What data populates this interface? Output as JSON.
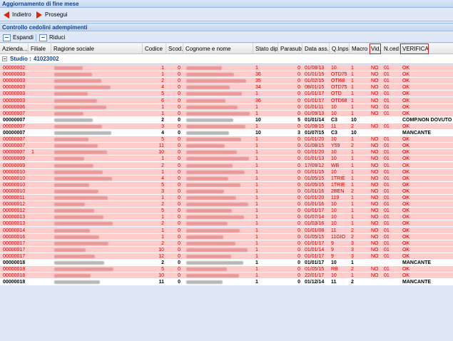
{
  "window": {
    "title": "Aggiornamento di fine mese"
  },
  "nav": {
    "back_label": "Indietro",
    "next_label": "Prosegui"
  },
  "section": {
    "title": "Controllo cedolini adempimenti"
  },
  "toolbar": {
    "expand_label": "Espandi",
    "collapse_label": "Riduci"
  },
  "columns": [
    "Azienda...",
    "Filiale",
    "Ragione sociale",
    "Codice",
    "Scod.",
    "Cognome e nome",
    "Stato dip.",
    "Parasub.",
    "Data ass.",
    "Q.Inps",
    "Macro",
    "Vid.",
    "N.ced",
    "VERIFICA"
  ],
  "group": {
    "label": "Studio :",
    "value": "41023002"
  },
  "rows": [
    {
      "azienda": "00000002",
      "filiale": "",
      "codice": "1",
      "scod": "0",
      "stato": "1",
      "parasub": "0",
      "data": "01/08/13",
      "qinps": "10",
      "macro": "1",
      "vid": "NO",
      "nced": "01",
      "verifica": "OK",
      "red": true
    },
    {
      "azienda": "00000003",
      "filiale": "",
      "codice": "1",
      "scod": "0",
      "stato": "36",
      "parasub": "0",
      "data": "01/01/15",
      "qinps": "OTD75",
      "macro": "1",
      "vid": "NO",
      "nced": "01",
      "verifica": "OK",
      "red": true
    },
    {
      "azienda": "00000003",
      "filiale": "",
      "codice": "2",
      "scod": "0",
      "stato": "35",
      "parasub": "0",
      "data": "01/02/15",
      "qinps": "OTI68",
      "macro": "1",
      "vid": "NO",
      "nced": "01",
      "verifica": "OK",
      "red": true
    },
    {
      "azienda": "00000003",
      "filiale": "",
      "codice": "4",
      "scod": "0",
      "stato": "34",
      "parasub": "0",
      "data": "08/01/15",
      "qinps": "OTD75",
      "macro": "1",
      "vid": "NO",
      "nced": "01",
      "verifica": "OK",
      "red": true
    },
    {
      "azienda": "00000003",
      "filiale": "",
      "codice": "5",
      "scod": "0",
      "stato": "1",
      "parasub": "0",
      "data": "01/01/17",
      "qinps": "OTD",
      "macro": "1",
      "vid": "NO",
      "nced": "01",
      "verifica": "OK",
      "red": true
    },
    {
      "azienda": "00000003",
      "filiale": "",
      "codice": "6",
      "scod": "0",
      "stato": "36",
      "parasub": "0",
      "data": "01/01/17",
      "qinps": "OTD68",
      "macro": "1",
      "vid": "NO",
      "nced": "01",
      "verifica": "OK",
      "red": true
    },
    {
      "azienda": "00000006",
      "filiale": "",
      "codice": "1",
      "scod": "0",
      "stato": "1",
      "parasub": "0",
      "data": "01/01/11",
      "qinps": "10",
      "macro": "1",
      "vid": "NO",
      "nced": "01",
      "verifica": "OK",
      "red": true
    },
    {
      "azienda": "00000007",
      "filiale": "",
      "codice": "1",
      "scod": "0",
      "stato": "1",
      "parasub": "0",
      "data": "01/09/13",
      "qinps": "10",
      "macro": "1",
      "vid": "NO",
      "nced": "01",
      "verifica": "OK",
      "red": true
    },
    {
      "azienda": "00000007",
      "filiale": "",
      "codice": "2",
      "scod": "0",
      "stato": "10",
      "parasub": "5",
      "data": "01/01/14",
      "qinps": "C3",
      "macro": "10",
      "vid": "",
      "nced": "",
      "verifica": "COMP.NON DOVUTO",
      "red": false
    },
    {
      "azienda": "00000007",
      "filiale": "",
      "codice": "3",
      "scod": "0",
      "stato": "1",
      "parasub": "0",
      "data": "01/08/15",
      "qinps": "11",
      "macro": "2",
      "vid": "NO",
      "nced": "01",
      "verifica": "OK",
      "red": true
    },
    {
      "azienda": "00000007",
      "filiale": "",
      "codice": "4",
      "scod": "0",
      "stato": "10",
      "parasub": "3",
      "data": "01/07/15",
      "qinps": "C3",
      "macro": "10",
      "vid": "",
      "nced": "",
      "verifica": "MANCANTE",
      "red": false
    },
    {
      "azienda": "00000007",
      "filiale": "",
      "codice": "5",
      "scod": "0",
      "stato": "1",
      "parasub": "0",
      "data": "01/01/20",
      "qinps": "10",
      "macro": "1",
      "vid": "NO",
      "nced": "01",
      "verifica": "OK",
      "red": true
    },
    {
      "azienda": "00000007",
      "filiale": "",
      "codice": "11",
      "scod": "0",
      "stato": "1",
      "parasub": "0",
      "data": "01/08/15",
      "qinps": "Y59",
      "macro": "2",
      "vid": "NO",
      "nced": "01",
      "verifica": "OK",
      "red": true
    },
    {
      "azienda": "00000007",
      "filiale": "1",
      "codice": "10",
      "scod": "0",
      "stato": "1",
      "parasub": "0",
      "data": "01/01/20",
      "qinps": "10",
      "macro": "1",
      "vid": "NO",
      "nced": "01",
      "verifica": "OK",
      "red": true
    },
    {
      "azienda": "00000009",
      "filiale": "",
      "codice": "1",
      "scod": "0",
      "stato": "1",
      "parasub": "0",
      "data": "01/01/13",
      "qinps": "10",
      "macro": "1",
      "vid": "NO",
      "nced": "01",
      "verifica": "OK",
      "red": true
    },
    {
      "azienda": "00000009",
      "filiale": "",
      "codice": "2",
      "scod": "0",
      "stato": "1",
      "parasub": "0",
      "data": "17/09/12",
      "qinps": "WB",
      "macro": "1",
      "vid": "NO",
      "nced": "01",
      "verifica": "OK",
      "red": true
    },
    {
      "azienda": "00000010",
      "filiale": "",
      "codice": "1",
      "scod": "0",
      "stato": "1",
      "parasub": "0",
      "data": "01/01/15",
      "qinps": "10",
      "macro": "1",
      "vid": "NO",
      "nced": "01",
      "verifica": "OK",
      "red": true
    },
    {
      "azienda": "00000010",
      "filiale": "",
      "codice": "4",
      "scod": "0",
      "stato": "1",
      "parasub": "0",
      "data": "01/05/15",
      "qinps": "1TRIE",
      "macro": "1",
      "vid": "NO",
      "nced": "01",
      "verifica": "OK",
      "red": true
    },
    {
      "azienda": "00000010",
      "filiale": "",
      "codice": "5",
      "scod": "0",
      "stato": "1",
      "parasub": "0",
      "data": "01/05/15",
      "qinps": "1TRIE",
      "macro": "1",
      "vid": "NO",
      "nced": "01",
      "verifica": "OK",
      "red": true
    },
    {
      "azienda": "00000010",
      "filiale": "",
      "codice": "3",
      "scod": "0",
      "stato": "1",
      "parasub": "0",
      "data": "01/01/16",
      "qinps": "2BEN",
      "macro": "2",
      "vid": "NO",
      "nced": "01",
      "verifica": "OK",
      "red": true
    },
    {
      "azienda": "00000011",
      "filiale": "",
      "codice": "1",
      "scod": "0",
      "stato": "1",
      "parasub": "0",
      "data": "01/01/20",
      "qinps": "119",
      "macro": "1",
      "vid": "NO",
      "nced": "01",
      "verifica": "OK",
      "red": true
    },
    {
      "azienda": "00000012",
      "filiale": "",
      "codice": "2",
      "scod": "0",
      "stato": "1",
      "parasub": "0",
      "data": "01/01/16",
      "qinps": "10",
      "macro": "1",
      "vid": "NO",
      "nced": "01",
      "verifica": "OK",
      "red": true
    },
    {
      "azienda": "00000012",
      "filiale": "",
      "codice": "5",
      "scod": "0",
      "stato": "1",
      "parasub": "0",
      "data": "01/01/17",
      "qinps": "10",
      "macro": "1",
      "vid": "NO",
      "nced": "01",
      "verifica": "OK",
      "red": true
    },
    {
      "azienda": "00000013",
      "filiale": "",
      "codice": "1",
      "scod": "0",
      "stato": "1",
      "parasub": "0",
      "data": "01/07/14",
      "qinps": "10",
      "macro": "1",
      "vid": "NO",
      "nced": "01",
      "verifica": "OK",
      "red": true
    },
    {
      "azienda": "00000013",
      "filiale": "",
      "codice": "2",
      "scod": "0",
      "stato": "1",
      "parasub": "0",
      "data": "01/03/16",
      "qinps": "10",
      "macro": "1",
      "vid": "NO",
      "nced": "01",
      "verifica": "OK",
      "red": true
    },
    {
      "azienda": "00000014",
      "filiale": "",
      "codice": "1",
      "scod": "0",
      "stato": "1",
      "parasub": "0",
      "data": "01/01/08",
      "qinps": "11",
      "macro": "2",
      "vid": "NO",
      "nced": "01",
      "verifica": "OK",
      "red": true
    },
    {
      "azienda": "00000016",
      "filiale": "",
      "codice": "1",
      "scod": "0",
      "stato": "1",
      "parasub": "0",
      "data": "01/05/15",
      "qinps": "11GIO",
      "macro": "2",
      "vid": "NO",
      "nced": "01",
      "verifica": "OK",
      "red": true
    },
    {
      "azienda": "00000017",
      "filiale": "",
      "codice": "2",
      "scod": "0",
      "stato": "1",
      "parasub": "0",
      "data": "01/01/17",
      "qinps": "9",
      "macro": "3",
      "vid": "NO",
      "nced": "01",
      "verifica": "OK",
      "red": true
    },
    {
      "azienda": "00000017",
      "filiale": "",
      "codice": "10",
      "scod": "0",
      "stato": "1",
      "parasub": "0",
      "data": "01/01/14",
      "qinps": "9",
      "macro": "3",
      "vid": "NO",
      "nced": "01",
      "verifica": "OK",
      "red": true
    },
    {
      "azienda": "00000017",
      "filiale": "",
      "codice": "12",
      "scod": "0",
      "stato": "1",
      "parasub": "0",
      "data": "01/01/17",
      "qinps": "9",
      "macro": "3",
      "vid": "NO",
      "nced": "01",
      "verifica": "OK",
      "red": true
    },
    {
      "azienda": "00000018",
      "filiale": "",
      "codice": "2",
      "scod": "0",
      "stato": "1",
      "parasub": "0",
      "data": "01/01/17",
      "qinps": "10",
      "macro": "1",
      "vid": "",
      "nced": "",
      "verifica": "MANCANTE",
      "red": false
    },
    {
      "azienda": "00000018",
      "filiale": "",
      "codice": "5",
      "scod": "0",
      "stato": "1",
      "parasub": "0",
      "data": "01/05/15",
      "qinps": "RB",
      "macro": "2",
      "vid": "NO",
      "nced": "01",
      "verifica": "OK",
      "red": true
    },
    {
      "azienda": "00000018",
      "filiale": "",
      "codice": "10",
      "scod": "0",
      "stato": "1",
      "parasub": "0",
      "data": "22/01/17",
      "qinps": "10",
      "macro": "1",
      "vid": "NO",
      "nced": "01",
      "verifica": "OK",
      "red": true
    },
    {
      "azienda": "00000018",
      "filiale": "",
      "codice": "11",
      "scod": "0",
      "stato": "1",
      "parasub": "0",
      "data": "01/12/14",
      "qinps": "11",
      "macro": "2",
      "vid": "",
      "nced": "",
      "verifica": "MANCANTE",
      "red": false
    }
  ]
}
